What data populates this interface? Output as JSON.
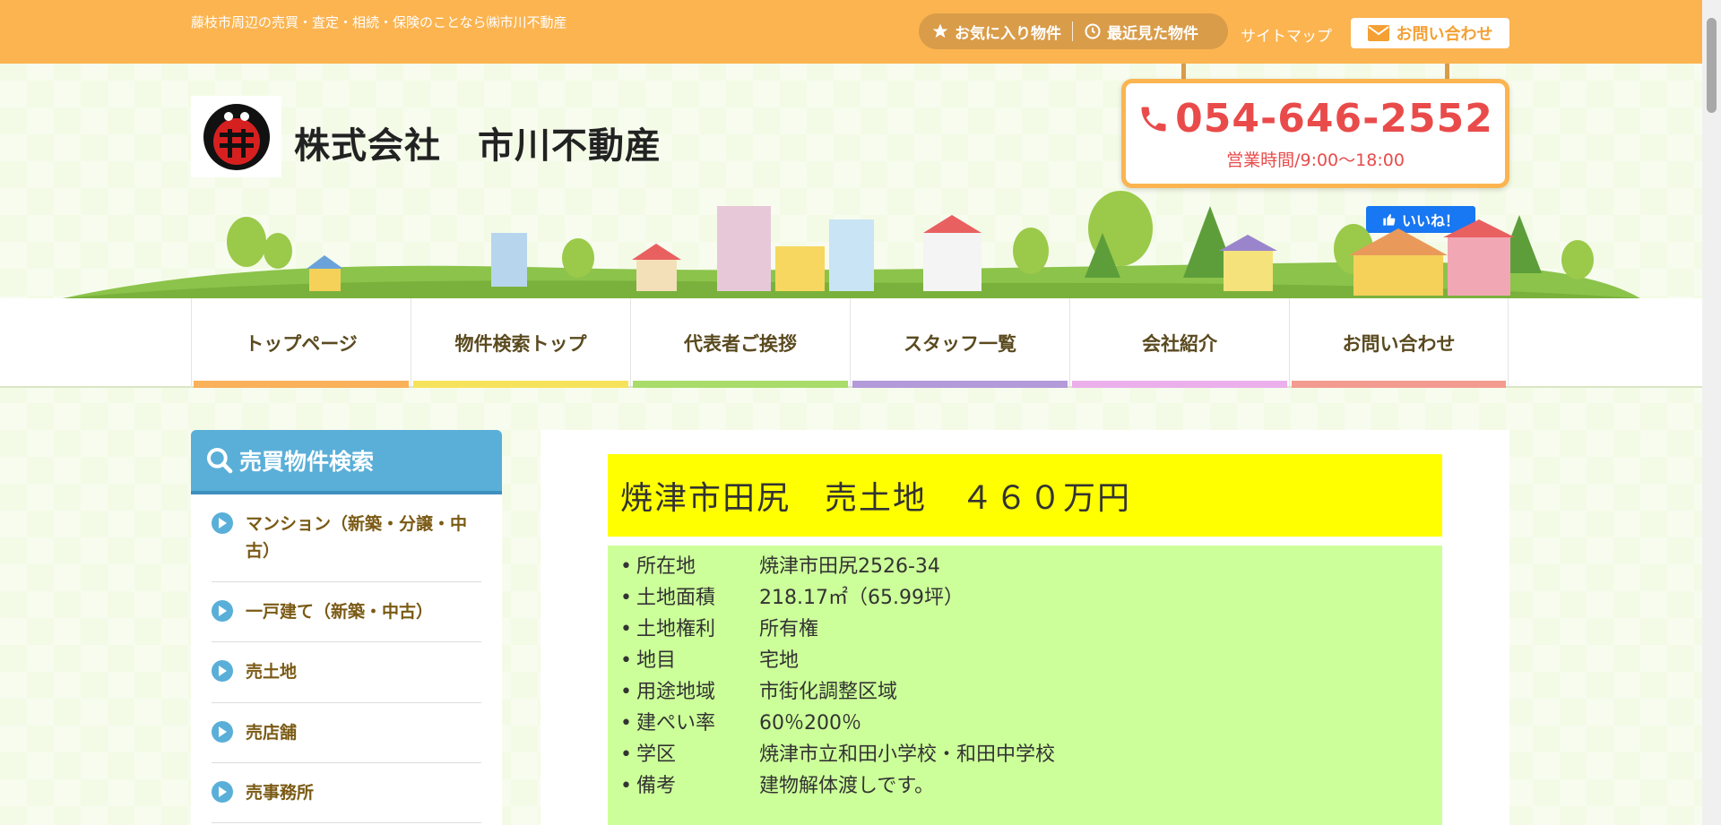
{
  "topbar": {
    "tagline": "藤枝市周辺の売買・査定・相続・保険のことなら㈱市川不動産",
    "favorites_label": "お気に入り物件",
    "recent_label": "最近見た物件",
    "sitemap_label": "サイトマップ",
    "contact_label": "お問い合わせ"
  },
  "header": {
    "company_name": "株式会社　市川不動産",
    "phone": "054-646-2552",
    "hours": "営業時間/9:00～18:00",
    "like_label": "いいね！"
  },
  "nav": {
    "items": [
      {
        "label": "トップページ",
        "color": "#f9b15a"
      },
      {
        "label": "物件検索トップ",
        "color": "#f7e35b"
      },
      {
        "label": "代表者ご挨拶",
        "color": "#a9dc6a"
      },
      {
        "label": "スタッフ一覧",
        "color": "#b39ad9"
      },
      {
        "label": "会社紹介",
        "color": "#ebb0eb"
      },
      {
        "label": "お問い合わせ",
        "color": "#f39b90"
      }
    ]
  },
  "sidebar": {
    "title": "売買物件検索",
    "items": [
      {
        "label": "マンション（新築・分譲・中古）"
      },
      {
        "label": "一戸建て（新築・中古）"
      },
      {
        "label": "売土地"
      },
      {
        "label": "売店舗"
      },
      {
        "label": "売事務所"
      }
    ]
  },
  "listing": {
    "title": "焼津市田尻　売土地　４６０万円",
    "details": [
      {
        "label": "所在地",
        "value": "焼津市田尻2526-34"
      },
      {
        "label": "土地面積",
        "value": "218.17㎡（65.99坪）"
      },
      {
        "label": "土地権利",
        "value": "所有権"
      },
      {
        "label": "地目",
        "value": "宅地"
      },
      {
        "label": "用途地域",
        "value": "市街化調整区域"
      },
      {
        "label": "建ぺい率",
        "value": "60％200％"
      },
      {
        "label": "学区",
        "value": "焼津市立和田小学校・和田中学校"
      },
      {
        "label": "備考",
        "value": "建物解体渡しです。"
      }
    ]
  },
  "colors": {
    "topbar": "#fbb450",
    "phone_red": "#e94b4b",
    "sidebar_blue": "#5aafd8",
    "title_yellow": "#ffff00",
    "details_green": "#ccff99"
  }
}
